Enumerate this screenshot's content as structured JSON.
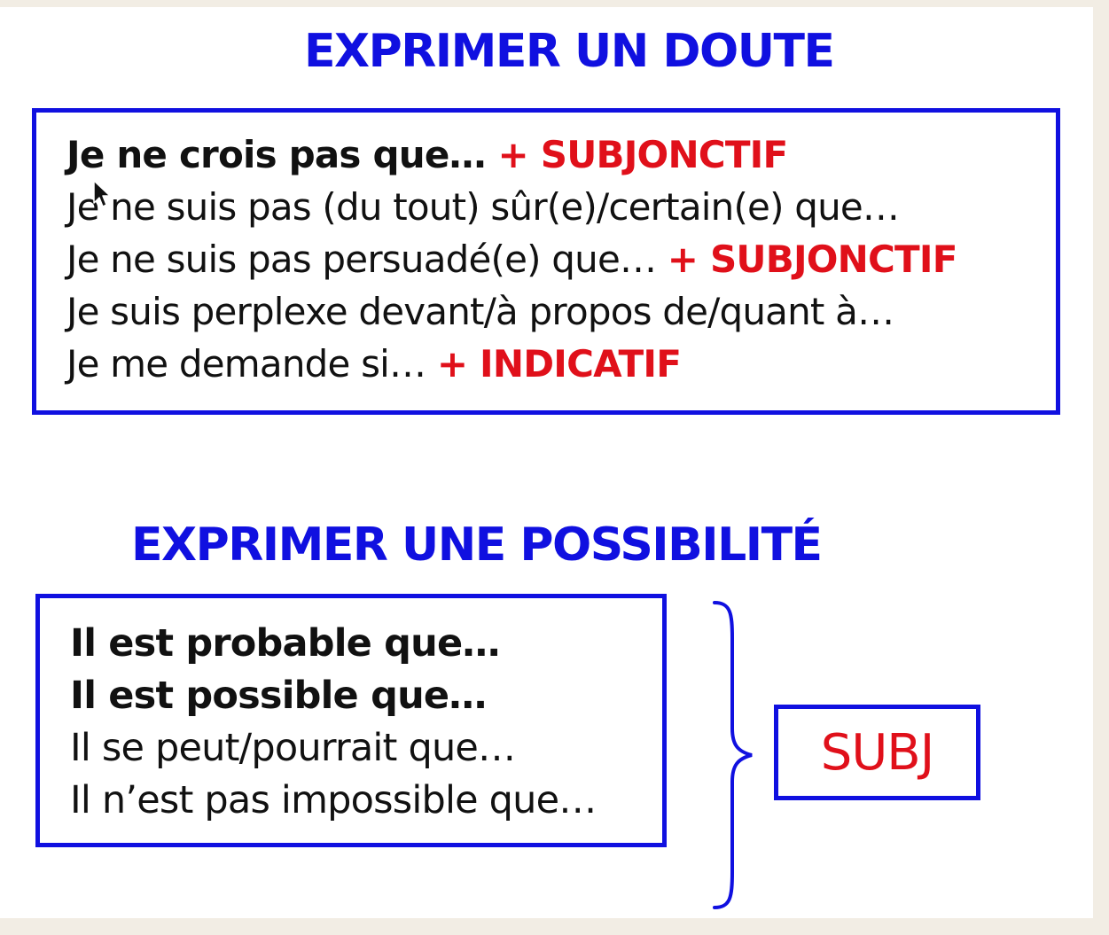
{
  "doubt": {
    "title": "EXPRIMER UN DOUTE",
    "lines": [
      {
        "text": "Je ne crois pas que… ",
        "mood": "+ SUBJONCTIF"
      },
      {
        "text": "Je ne suis pas (du tout) sûr(e)/certain(e) que…",
        "mood": ""
      },
      {
        "text": "Je ne suis pas persuadé(e) que… ",
        "mood": "+ SUBJONCTIF"
      },
      {
        "text": "Je suis perplexe devant/à propos de/quant à…",
        "mood": ""
      },
      {
        "text": "Je me demande si… ",
        "mood": "+ INDICATIF"
      }
    ]
  },
  "possibility": {
    "title": "EXPRIMER UNE POSSIBILITÉ",
    "lines": [
      "Il est probable que…",
      "Il est possible que…",
      "Il se peut/pourrait que…",
      "Il n’est pas impossible que…"
    ],
    "result": "SUBJ"
  },
  "colors": {
    "heading": "#1010e0",
    "border": "#1010e0",
    "mood": "#e0101a",
    "text": "#111111"
  },
  "icons": [
    "mouse-cursor-icon",
    "curly-brace-icon"
  ]
}
